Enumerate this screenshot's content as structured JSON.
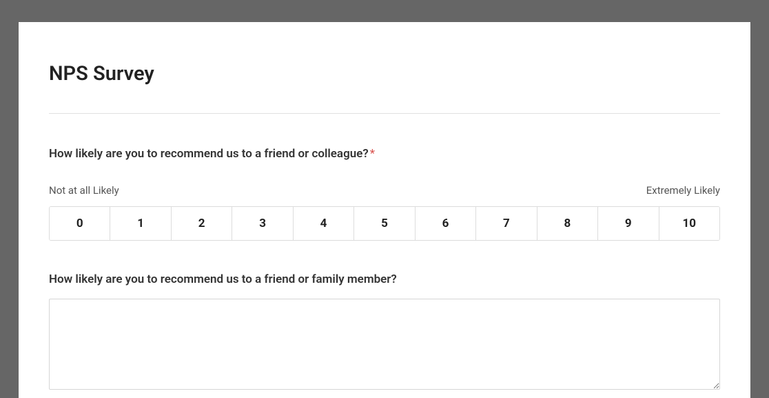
{
  "survey": {
    "title": "NPS Survey"
  },
  "q1": {
    "label": "How likely are you to recommend us to a friend or colleague?",
    "required_marker": "*",
    "scale_min_label": "Not at all Likely",
    "scale_max_label": "Extremely Likely",
    "options": [
      "0",
      "1",
      "2",
      "3",
      "4",
      "5",
      "6",
      "7",
      "8",
      "9",
      "10"
    ]
  },
  "q2": {
    "label": "How likely are you to recommend us to a friend or family member?",
    "value": ""
  }
}
